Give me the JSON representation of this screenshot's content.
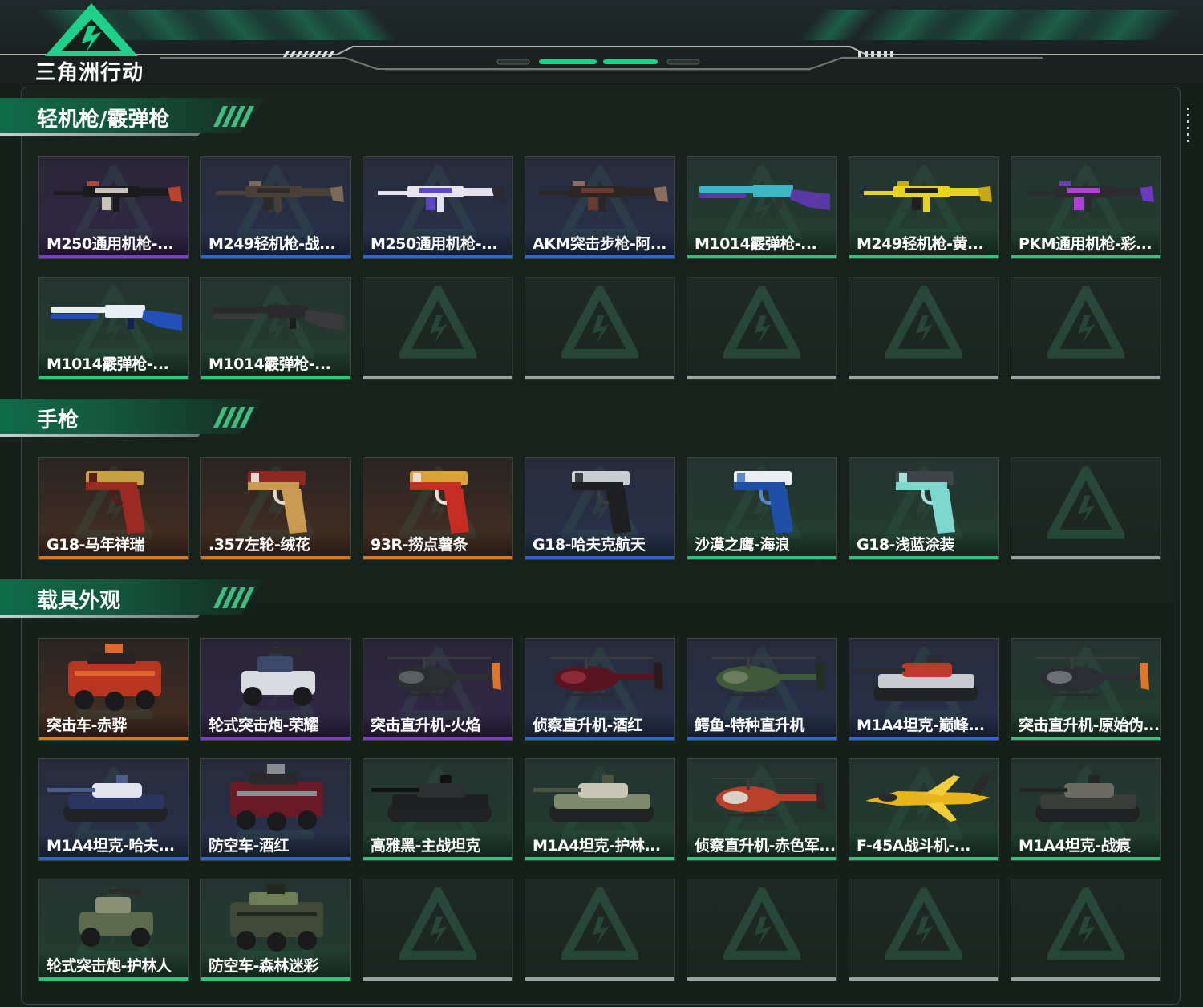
{
  "header": {
    "logo_text": "三角洲行动"
  },
  "colors": {
    "gold": "#d9781f",
    "purple": "#7d3cc8",
    "blue": "#2f64d6",
    "green": "#2fc47a",
    "empty": "#9aa4a0",
    "accent": "#1fd08a"
  },
  "sections": [
    {
      "title": "轻机枪/霰弹枪",
      "items": [
        {
          "label": "M250通用机枪-...",
          "rarity": "purple",
          "art": "lmg-black"
        },
        {
          "label": "M249轻机枪-战...",
          "rarity": "blue",
          "art": "lmg-olive"
        },
        {
          "label": "M250通用机枪-...",
          "rarity": "blue",
          "art": "lmg-purple"
        },
        {
          "label": "AKM突击步枪-阿...",
          "rarity": "blue",
          "art": "rifle-red"
        },
        {
          "label": "M1014霰弹枪-...",
          "rarity": "green",
          "art": "shotgun-cyan"
        },
        {
          "label": "M249轻机枪-黄...",
          "rarity": "green",
          "art": "lmg-yellow"
        },
        {
          "label": "PKM通用机枪-彩...",
          "rarity": "green",
          "art": "lmg-violet"
        },
        {
          "label": "M1014霰弹枪-...",
          "rarity": "green",
          "art": "shotgun-blue"
        },
        {
          "label": "M1014霰弹枪-...",
          "rarity": "green",
          "art": "shotgun-black"
        },
        {
          "label": "",
          "rarity": "empty",
          "art": ""
        },
        {
          "label": "",
          "rarity": "empty",
          "art": ""
        },
        {
          "label": "",
          "rarity": "empty",
          "art": ""
        },
        {
          "label": "",
          "rarity": "empty",
          "art": ""
        },
        {
          "label": "",
          "rarity": "empty",
          "art": ""
        }
      ]
    },
    {
      "title": "手枪",
      "items": [
        {
          "label": "G18-马年祥瑞",
          "rarity": "gold",
          "art": "pistol-red"
        },
        {
          "label": ".357左轮-绒花",
          "rarity": "gold",
          "art": "revolver-gold"
        },
        {
          "label": "93R-捞点薯条",
          "rarity": "gold",
          "art": "pistol-redgold"
        },
        {
          "label": "G18-哈夫克航天",
          "rarity": "blue",
          "art": "pistol-black"
        },
        {
          "label": "沙漠之鹰-海浪",
          "rarity": "green",
          "art": "deagle-blue"
        },
        {
          "label": "G18-浅蓝涂装",
          "rarity": "green",
          "art": "pistol-teal"
        },
        {
          "label": "",
          "rarity": "empty",
          "art": ""
        }
      ]
    },
    {
      "title": "载具外观",
      "items": [
        {
          "label": "突击车-赤骅",
          "rarity": "gold",
          "art": "truck-red"
        },
        {
          "label": "轮式突击炮-荣耀",
          "rarity": "purple",
          "art": "buggy-white"
        },
        {
          "label": "突击直升机-火焰",
          "rarity": "purple",
          "art": "heli-flame"
        },
        {
          "label": "侦察直升机-酒红",
          "rarity": "blue",
          "art": "heli-wine"
        },
        {
          "label": "鳄鱼-特种直升机",
          "rarity": "blue",
          "art": "heli-green"
        },
        {
          "label": "M1A4坦克-巅峰...",
          "rarity": "blue",
          "art": "tank-red"
        },
        {
          "label": "突击直升机-原始伪...",
          "rarity": "green",
          "art": "heli-orange"
        },
        {
          "label": "M1A4坦克-哈夫...",
          "rarity": "blue",
          "art": "tank-blue"
        },
        {
          "label": "防空车-酒红",
          "rarity": "blue",
          "art": "apc-wine"
        },
        {
          "label": "高雅黑-主战坦克",
          "rarity": "green",
          "art": "tank-black"
        },
        {
          "label": "M1A4坦克-护林...",
          "rarity": "green",
          "art": "tank-camo"
        },
        {
          "label": "侦察直升机-赤色军...",
          "rarity": "green",
          "art": "heli-redcamo"
        },
        {
          "label": "F-45A战斗机-...",
          "rarity": "green",
          "art": "jet-yellow"
        },
        {
          "label": "M1A4坦克-战痕",
          "rarity": "green",
          "art": "tank-dark"
        },
        {
          "label": "轮式突击炮-护林人",
          "rarity": "green",
          "art": "buggy-camo"
        },
        {
          "label": "防空车-森林迷彩",
          "rarity": "green",
          "art": "apc-camo"
        },
        {
          "label": "",
          "rarity": "empty",
          "art": ""
        },
        {
          "label": "",
          "rarity": "empty",
          "art": ""
        },
        {
          "label": "",
          "rarity": "empty",
          "art": ""
        },
        {
          "label": "",
          "rarity": "empty",
          "art": ""
        },
        {
          "label": "",
          "rarity": "empty",
          "art": ""
        }
      ]
    }
  ]
}
